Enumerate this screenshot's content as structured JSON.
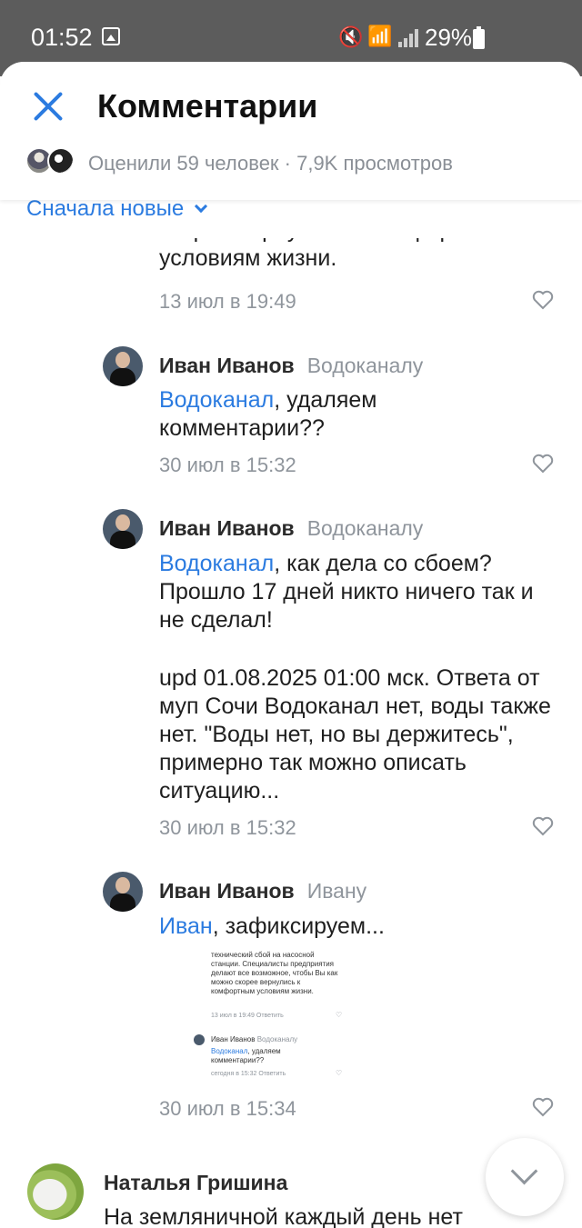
{
  "status_bar": {
    "time": "01:52",
    "battery": "29%"
  },
  "header": {
    "title": "Комментарии",
    "likes_summary": "Оценили 59 человек · 7,9K просмотров",
    "sort_label": "Сначала новые"
  },
  "comments": [
    {
      "text_partial": "скорее вернулись к комфортным условиям жизни.",
      "date": "13 июл в 19:49"
    },
    {
      "author": "Иван Иванов",
      "reply_to": "Водоканалу",
      "mention": "Водоканал",
      "text": ", удаляем комментарии??",
      "date": "30 июл в 15:32"
    },
    {
      "author": "Иван Иванов",
      "reply_to": "Водоканалу",
      "mention": "Водоканал",
      "text": ", как дела со сбоем? Прошло 17 дней никто ничего так и не сделал!",
      "text_update": "upd 01.08.2025 01:00 мск. Ответа от муп Сочи Водоканал нет, воды также нет. \"Воды нет, но вы держитесь\", примерно так можно описать ситуацию...",
      "date": "30 июл в 15:32"
    },
    {
      "author": "Иван Иванов",
      "reply_to": "Ивану",
      "mention": "Иван",
      "text": ", зафиксируем...",
      "date": "30 июл в 15:34",
      "attachment": {
        "text": "технический сбой на насосной станции. Специалисты предприятия делают все возможное, чтобы Вы как можно скорее вернулись к комфортным условиям жизни.",
        "meta1": "13 июл в 19:49   Ответить",
        "author": "Иван Иванов",
        "reply_to": "Водоканалу",
        "mention": "Водоканал",
        "reply_text": ", удаляем комментарии??",
        "meta2": "сегодня в 15:32   Ответить"
      }
    },
    {
      "author": "Наталья Гришина",
      "text_partial": "На земляничной каждый день нет"
    }
  ]
}
